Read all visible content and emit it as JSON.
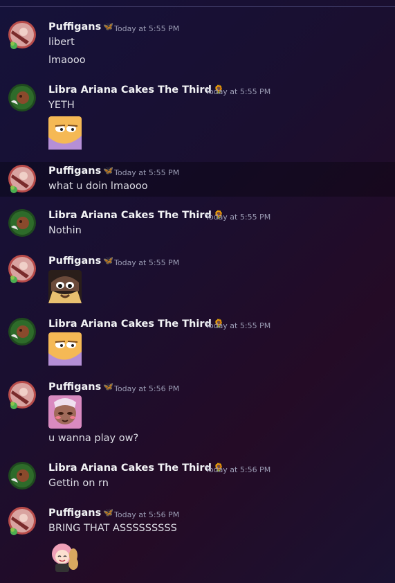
{
  "messages": [
    {
      "author": "Puffigans",
      "time": "Today at 5:55 PM",
      "lines": [
        "libert",
        "lmaooo"
      ]
    },
    {
      "author": "Libra Ariana Cakes The Third",
      "time": "Today at 5:55 PM",
      "lines": [
        "YETH"
      ]
    },
    {
      "author": "Puffigans",
      "time": "Today at 5:55 PM",
      "lines": [
        "what u doin lmaooo"
      ]
    },
    {
      "author": "Libra Ariana Cakes The Third",
      "time": "Today at 5:55 PM",
      "lines": [
        "Nothin"
      ]
    },
    {
      "author": "Puffigans",
      "time": "Today at 5:55 PM",
      "lines": []
    },
    {
      "author": "Libra Ariana Cakes The Third",
      "time": "Today at 5:55 PM",
      "lines": []
    },
    {
      "author": "Puffigans",
      "time": "Today at 5:56 PM",
      "lines": [
        "u wanna play ow?"
      ]
    },
    {
      "author": "Libra Ariana Cakes The Third",
      "time": "Today at 5:56 PM",
      "lines": [
        "Gettin on rn"
      ]
    },
    {
      "author": "Puffigans",
      "time": "Today at 5:56 PM",
      "lines": [
        "BRING THAT ASSSSSSSSS"
      ]
    }
  ],
  "badges": {
    "puffigans": "🦋",
    "libra": "🌻"
  },
  "icons": {
    "avatar_puffigans": "avatar-puffigans",
    "avatar_libra": "avatar-libra",
    "emoji_smug": "smug-emoji",
    "emoji_peek": "peeking-emoji",
    "emoji_blush": "blushing-emoji",
    "emoji_peanut": "peanut-girl-emoji"
  },
  "colors": {
    "accent": "#f2f3f5",
    "timestamp": "#9c9db5",
    "text": "#dedee6"
  }
}
